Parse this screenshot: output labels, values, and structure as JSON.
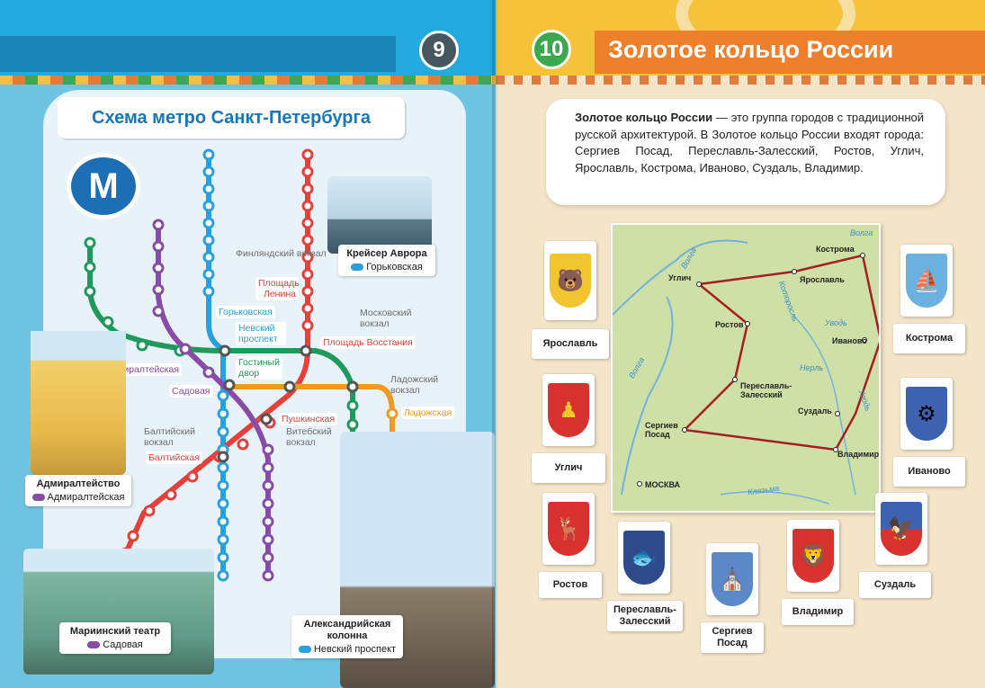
{
  "left_page": {
    "page_number": "9",
    "title": "Схема метро Санкт-Петербурга",
    "metro_logo": "M",
    "colors": {
      "red": "#e5403a",
      "blue": "#2aa0dc",
      "green": "#1f9a5c",
      "orange": "#ef9a20",
      "purple": "#8a4aa8"
    },
    "stations": {
      "nevsky": "Невский проспект",
      "gorkovskaya": "Горьковская",
      "lenina": "Площадь Ленина",
      "vosstaniya": "Площадь Восстания",
      "gostiny": "Гостиный двор",
      "admiralteyskaya": "Адмиралтейская",
      "sadovaya": "Садовая",
      "pushkinskaya": "Пушкинская",
      "baltiyskaya": "Балтийская",
      "ladozhskaya": "Ладожская"
    },
    "stations_gray": {
      "finlyandsky": "Финляндский вокзал",
      "moskovsky": "Московский вокзал",
      "ladozhsky": "Ладожский вокзал",
      "baltiysky": "Балтийский вокзал",
      "vitebsky": "Витебский вокзал"
    },
    "landmarks": [
      {
        "title": "Крейсер Аврора",
        "station": "Горьковская"
      },
      {
        "title": "Адмиралтейство",
        "station": "Адмиралтейская"
      },
      {
        "title": "Мариинский театр",
        "station": "Садовая"
      },
      {
        "title": "Александрийская колонна",
        "station": "Невский проспект"
      }
    ]
  },
  "right_page": {
    "page_number": "10",
    "title": "Золотое кольцо России",
    "intro_bold": "Золотое кольцо России",
    "intro_text": " — это группа городов с традиционной русской архитектурой. В Золотое кольцо России входят города: Сергиев Посад, Переславль-Залесский, Ростов, Углич, Ярославль, Кострома, Иваново, Суздаль, Владимир.",
    "map_cities": {
      "kostroma": "Кострома",
      "yaroslavl": "Ярославль",
      "uglich": "Углич",
      "rostov": "Ростов",
      "ivanovo": "Иваново",
      "pereslavl": "Переславль-Залесский",
      "suzdal": "Суздаль",
      "sergiev": "Сергиев Посад",
      "vladimir": "Владимир",
      "moscow": "МОСКВА"
    },
    "rivers": {
      "volga1": "Волга",
      "volga2": "Волга",
      "volga3": "Волга",
      "kotorosl": "Которосль",
      "uvod1": "Уводь",
      "uvod2": "Уводь",
      "nerl": "Нерль",
      "klyazma": "Клязьма"
    },
    "coats": {
      "yaroslavl": "Ярославль",
      "kostroma": "Кострома",
      "uglich": "Углич",
      "ivanovo": "Иваново",
      "rostov": "Ростов",
      "suzdal": "Суздаль",
      "pereslavl": "Переславль-Залесский",
      "sergiev": "Сергиев Посад",
      "vladimir": "Владимир"
    }
  }
}
